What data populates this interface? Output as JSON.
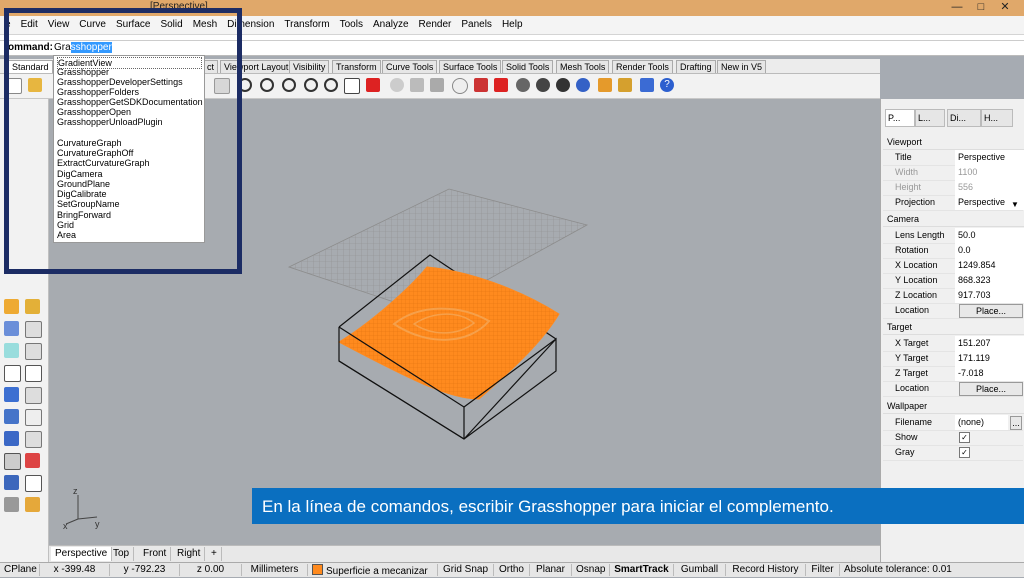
{
  "window": {
    "title": "[Perspective]",
    "controls": [
      "—",
      "□",
      "✕"
    ]
  },
  "menu": [
    "e",
    "Edit",
    "View",
    "Curve",
    "Surface",
    "Solid",
    "Mesh",
    "Dimension",
    "Transform",
    "Tools",
    "Analyze",
    "Render",
    "Panels",
    "Help"
  ],
  "command": {
    "label": "ommand:",
    "typed": "Gra",
    "completion": "sshopper"
  },
  "toolbar_tabs": [
    "Standard",
    "ct",
    "Viewport Layout",
    "Visibility",
    "Transform",
    "Curve Tools",
    "Surface Tools",
    "Solid Tools",
    "Mesh Tools",
    "Render Tools",
    "Drafting",
    "New in V5"
  ],
  "autocomplete": [
    "GradientView",
    "Grasshopper",
    "GrasshopperDeveloperSettings",
    "GrasshopperFolders",
    "GrasshopperGetSDKDocumentation",
    "GrasshopperOpen",
    "GrasshopperUnloadPlugin",
    "",
    "CurvatureGraph",
    "CurvatureGraphOff",
    "ExtractCurvatureGraph",
    "DigCamera",
    "GroundPlane",
    "DigCalibrate",
    "SetGroupName",
    "BringForward",
    "Grid",
    "Area"
  ],
  "panel_tabs": [
    "P...",
    "L...",
    "Di...",
    "H..."
  ],
  "properties": {
    "viewport_head": "Viewport",
    "title_k": "Title",
    "title_v": "Perspective",
    "width_k": "Width",
    "width_v": "1100",
    "height_k": "Height",
    "height_v": "556",
    "projection_k": "Projection",
    "projection_v": "Perspective",
    "camera_head": "Camera",
    "lens_k": "Lens Length",
    "lens_v": "50.0",
    "rotation_k": "Rotation",
    "rotation_v": "0.0",
    "xloc_k": "X Location",
    "xloc_v": "1249.854",
    "yloc_k": "Y Location",
    "yloc_v": "868.323",
    "zloc_k": "Z Location",
    "zloc_v": "917.703",
    "location_k": "Location",
    "place_label": "Place...",
    "target_head": "Target",
    "xt_k": "X Target",
    "xt_v": "151.207",
    "yt_k": "Y Target",
    "yt_v": "171.119",
    "zt_k": "Z Target",
    "zt_v": "-7.018",
    "tlocation_k": "Location",
    "wallpaper_head": "Wallpaper",
    "filename_k": "Filename",
    "filename_v": "(none)",
    "browse_label": "...",
    "show_k": "Show",
    "gray_k": "Gray",
    "check": "✓"
  },
  "viewport_tabs": [
    "Perspective",
    "Top",
    "Front",
    "Right",
    "+"
  ],
  "axes": {
    "x": "x",
    "y": "y",
    "z": "z"
  },
  "caption": "En la línea de comandos, escribir Grasshopper para iniciar el complemento.",
  "status": {
    "cplane": "CPlane",
    "x": "x -399.48",
    "y": "y -792.23",
    "z": "z 0.00",
    "units": "Millimeters",
    "layer": "Superficie a mecanizar",
    "grid_snap": "Grid Snap",
    "ortho": "Ortho",
    "planar": "Planar",
    "osnap": "Osnap",
    "smarttrack": "SmartTrack",
    "gumball": "Gumball",
    "record": "Record History",
    "filter": "Filter",
    "tolerance": "Absolute tolerance: 0.01"
  },
  "colors": {
    "surface": "#ff8a1e",
    "caption_bg": "#0a6fc0",
    "layer_swatch": "#ff8a1e",
    "highlight_box": "#1c2c64"
  }
}
